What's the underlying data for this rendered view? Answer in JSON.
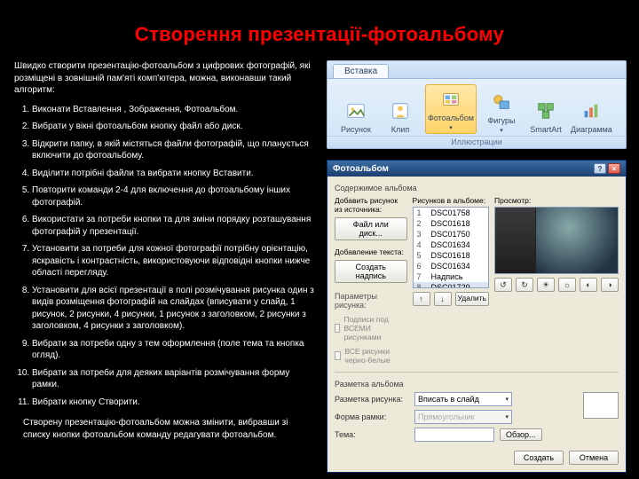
{
  "title": "Створення презентації-фотоальбому",
  "intro": "Швидко створити презентацію-фотоальбом з цифрових фотографій, які розміщені в зовнішній пам'яті комп'ютера, можна, виконавши такий алгоритм:",
  "steps": [
    "Виконати Вставлення , Зображення, Фотоальбом.",
    "Вибрати у вікні фотоальбом кнопку файл або диск.",
    "Відкрити папку, в якій містяться файли фотографій, що планується включити до фотоальбому.",
    "Виділити потрібні файли та вибрати кнопку Вставити.",
    "Повторити команди 2-4 для включення до фотоальбому інших фотографій.",
    "Використати за потреби кнопки  та  для зміни порядку розташування фотографій у презентації.",
    "Установити за потреби для кожної фотографії потрібну орієнтацію, яскравість і контрастність, використовуючи відповідні кнопки нижче області перегляду.",
    "Установити для всієї презентації в полі розмічування рисунка один з видів розміщення фотографій на слайдах (вписувати у слайд, 1 рисунок, 2 рисунки, 4 рисунки, 1 рисунок з заголовком, 2 рисунки з заголовком, 4 рисунки з заголовком).",
    "Вибрати за потреби одну з тем оформлення (поле тема та кнопка огляд).",
    "Вибрати за потреби для деяких варіантів розмічування форму рамки.",
    "Вибрати кнопку Створити."
  ],
  "outro": "Створену презентацію-фотоальбом можна змінити, вибравши зі списку кнопки фотоальбом команду редагувати фотоальбом.",
  "ribbon": {
    "tab": "Вставка",
    "items": {
      "picture": "Рисунок",
      "clip": "Клип",
      "photoalbum": "Фотоальбом",
      "shapes": "Фигуры",
      "smartart": "SmartArt",
      "chart": "Диаграмма"
    },
    "group": "Иллюстрации"
  },
  "dialog": {
    "title": "Фотоальбом",
    "section_content": "Содержимое альбома",
    "insert_from": "Добавить рисунок из источника:",
    "btn_file": "Файл или диск...",
    "add_text": "Добавление текста:",
    "btn_caption": "Создать надпись",
    "params": "Параметры рисунка:",
    "chk_caption": "Подписи под ВСЕМИ рисунками",
    "chk_bw": "ВСЕ рисунки черно-белые",
    "list_header": "Рисунков в альбоме:",
    "preview_header": "Просмотр:",
    "files": [
      "DSC01758",
      "DSC01618",
      "DSC01750",
      "DSC01634",
      "DSC01618",
      "DSC01634",
      "Надпись",
      "DSC01729"
    ],
    "btn_remove": "Удалить",
    "layout_title": "Разметка альбома",
    "lbl_layout": "Разметка рисунка:",
    "val_layout": "Вписать в слайд",
    "lbl_frame": "Форма рамки:",
    "val_frame": "Прямоугольник",
    "lbl_theme": "Тема:",
    "btn_browse": "Обзор...",
    "btn_create": "Создать",
    "btn_cancel": "Отмена"
  }
}
